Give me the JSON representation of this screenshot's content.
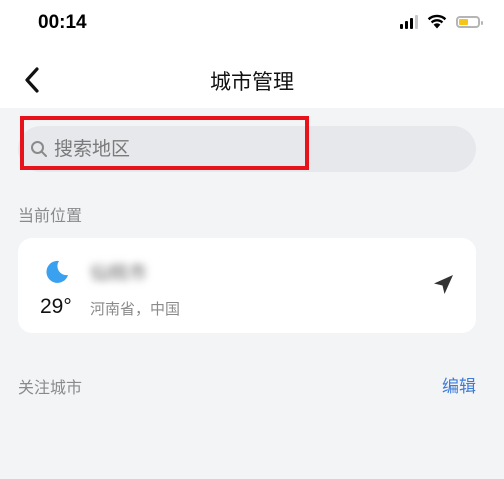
{
  "status_bar": {
    "time": "00:14",
    "icons": [
      "signal-icon",
      "wifi-icon",
      "battery-icon"
    ],
    "battery_color": "#f5c518"
  },
  "nav": {
    "title": "城市管理",
    "back_icon": "chevron-left-icon"
  },
  "search": {
    "placeholder": "搜索地区",
    "value": "",
    "icon": "search-icon",
    "highlight_color": "#e8121b"
  },
  "current_location": {
    "label": "当前位置",
    "weather_icon": "moon-icon",
    "weather_icon_color": "#3aa0f0",
    "city_name": "仙桃市",
    "temperature": "29°",
    "region": "河南省，中国",
    "locate_icon": "location-arrow-icon"
  },
  "followed": {
    "label": "关注城市",
    "edit_label": "编辑",
    "accent_color": "#3d7bd8"
  }
}
